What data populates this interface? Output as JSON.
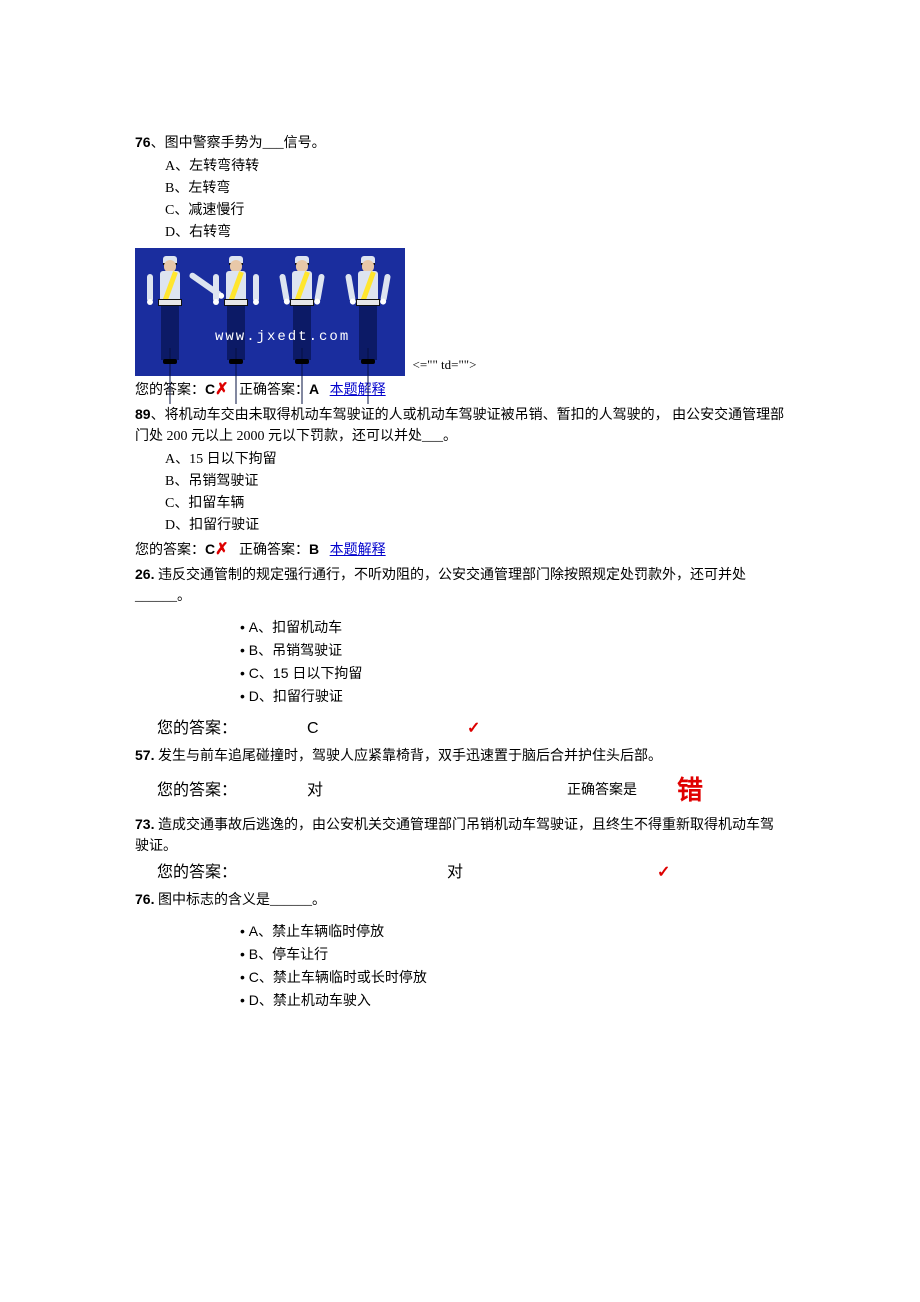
{
  "common": {
    "your_answer_label": "您的答案：",
    "correct_answer_label_short": "正确答案：",
    "correct_answer_label_is": "正确答案是",
    "explain_link": "本题解释",
    "x_mark_glyph": "✗",
    "check_mark_glyph": "✓",
    "bullet": "•"
  },
  "q76a": {
    "number": "76",
    "stem": "、图中警察手势为___信号。",
    "options": {
      "A": "A、左转弯待转",
      "B": "B、左转弯",
      "C": "C、减速慢行",
      "D": "D、右转弯"
    },
    "image_watermark": "www.jxedt.com",
    "after_image_text": "<=\"\" td=\"\">",
    "your_answer": "C",
    "correct_answer": "A"
  },
  "q89": {
    "number": "89",
    "stem": "、将机动车交由未取得机动车驾驶证的人或机动车驾驶证被吊销、暂扣的人驾驶的，  由公安交通管理部门处 200 元以上 2000 元以下罚款，还可以并处___。",
    "options": {
      "A": "A、15 日以下拘留",
      "B": "B、吊销驾驶证",
      "C": "C、扣留车辆",
      "D": "D、扣留行驶证"
    },
    "your_answer": "C",
    "correct_answer": "B"
  },
  "q26": {
    "number": "26.",
    "stem": " 违反交通管制的规定强行通行，不听劝阻的，公安交通管理部门除按照规定处罚款外，还可并处______。",
    "options": {
      "A": "A、扣留机动车",
      "B": "B、吊销驾驶证",
      "C": "C、15 日以下拘留",
      "D": "D、扣留行驶证"
    },
    "your_answer": "C"
  },
  "q57": {
    "number": "57.",
    "stem": " 发生与前车追尾碰撞时，驾驶人应紧靠椅背，双手迅速置于脑后合并护住头后部。",
    "your_answer": "对",
    "correct_answer": "错"
  },
  "q73": {
    "number": "73.",
    "stem": " 造成交通事故后逃逸的，由公安机关交通管理部门吊销机动车驾驶证，且终生不得重新取得机动车驾驶证。",
    "your_answer": "对"
  },
  "q76b": {
    "number": "76.",
    "stem": " 图中标志的含义是______。",
    "options": {
      "A": "A、禁止车辆临时停放",
      "B": "B、停车让行",
      "C": "C、禁止车辆临时或长时停放",
      "D": "D、禁止机动车驶入"
    }
  }
}
